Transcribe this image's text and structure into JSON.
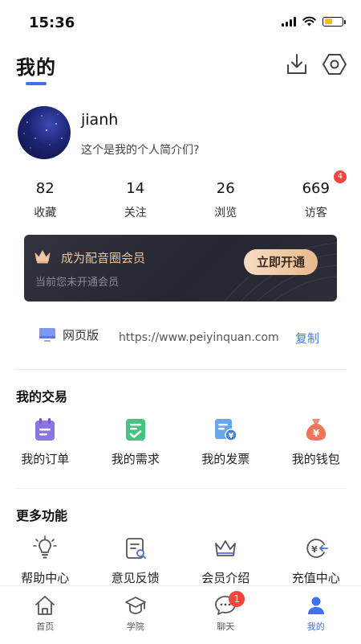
{
  "status_bar": {
    "time": "15:36"
  },
  "header": {
    "title": "我的"
  },
  "profile": {
    "username": "jianh",
    "bio": "这个是我的个人简介们?"
  },
  "stats": [
    {
      "value": "82",
      "label": "收藏"
    },
    {
      "value": "14",
      "label": "关注"
    },
    {
      "value": "26",
      "label": "浏览"
    },
    {
      "value": "669",
      "label": "访客",
      "badge": "4"
    }
  ],
  "vip": {
    "title": "成为配音圈会员",
    "subtitle": "当前您未开通会员",
    "button": "立即开通"
  },
  "web": {
    "label": "网页版",
    "url": "https://www.peiyinquan.com",
    "copy": "复制"
  },
  "transactions": {
    "title": "我的交易",
    "items": [
      {
        "label": "我的订单",
        "icon": "order-icon"
      },
      {
        "label": "我的需求",
        "icon": "demand-icon"
      },
      {
        "label": "我的发票",
        "icon": "invoice-icon"
      },
      {
        "label": "我的钱包",
        "icon": "wallet-icon"
      }
    ]
  },
  "more": {
    "title": "更多功能",
    "items": [
      {
        "label": "帮助中心",
        "icon": "help-bulb-icon"
      },
      {
        "label": "意见反馈",
        "icon": "feedback-icon"
      },
      {
        "label": "会员介绍",
        "icon": "crown-icon"
      },
      {
        "label": "充值中心",
        "icon": "recharge-icon"
      }
    ]
  },
  "tabbar": {
    "items": [
      {
        "label": "首页",
        "icon": "home-icon"
      },
      {
        "label": "学院",
        "icon": "academy-cap-icon"
      },
      {
        "label": "聊天",
        "icon": "chat-icon",
        "badge": "1"
      },
      {
        "label": "我的",
        "icon": "profile-icon",
        "active": true
      }
    ]
  },
  "colors": {
    "accent": "#3f6ff3",
    "badge": "#f2453d",
    "vip_gold": "#e8c49a",
    "link": "#3f7be8"
  }
}
